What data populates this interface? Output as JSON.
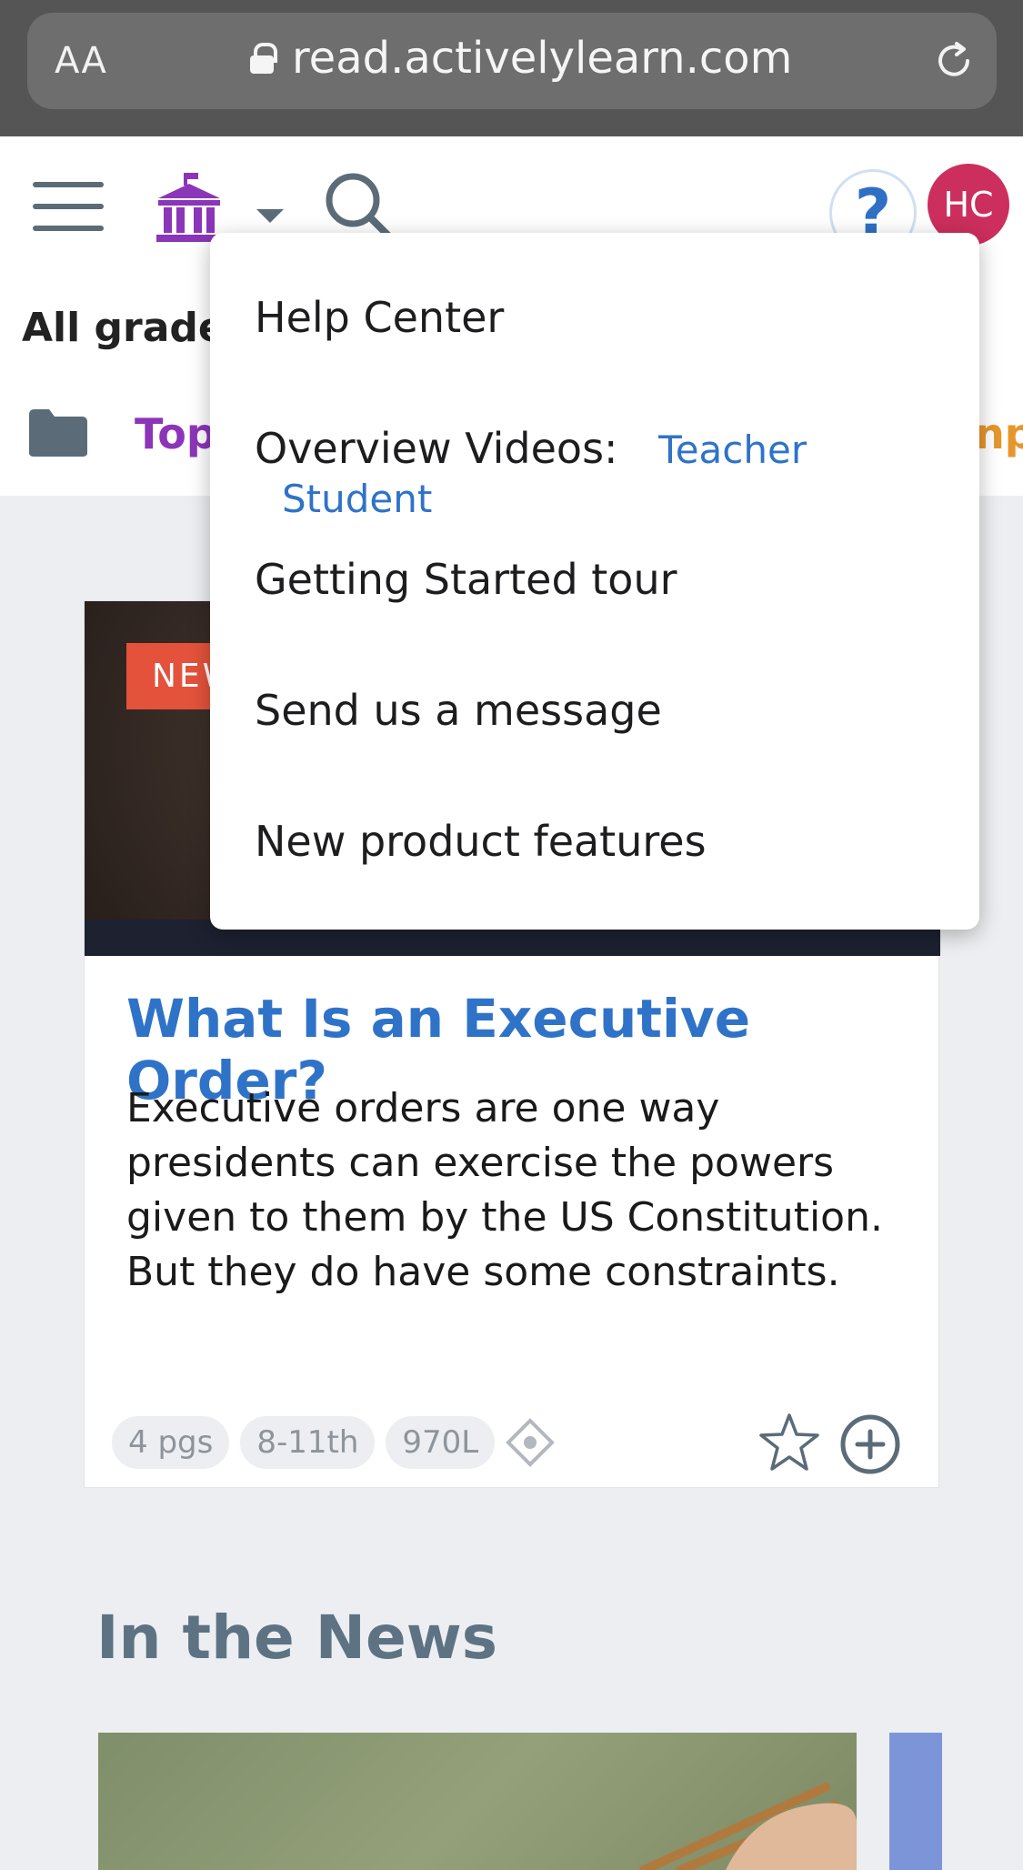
{
  "browser": {
    "text_size_label": "AA",
    "url": "read.activelylearn.com"
  },
  "header": {
    "help_label": "?",
    "avatar_initials": "HC",
    "grade_filter_label": "All grades",
    "topics_label": "Top",
    "clipped_right_label": "np"
  },
  "help_menu": {
    "help_center": "Help Center",
    "overview_videos_label": "Overview Videos:",
    "teacher_link": "Teacher",
    "student_link": "Student",
    "getting_started": "Getting Started tour",
    "send_message": "Send us a message",
    "new_features": "New product features"
  },
  "card": {
    "badge": "NEW",
    "title": "What Is an Executive Order?",
    "description": "Executive orders are one way presidents can exercise the powers given to them by the US Constitution. But they do have some constraints.",
    "pages": "4 pgs",
    "grades": "8-11th",
    "lexile": "970L"
  },
  "sections": {
    "in_the_news": "In the News"
  },
  "colors": {
    "accent_blue": "#2f73c8",
    "avatar": "#cc2e5d",
    "library_purple": "#8b35b8",
    "badge_red": "#e4523b"
  },
  "icons": {
    "menu": "hamburger-icon",
    "library": "library-icon",
    "search": "search-icon",
    "help": "question-icon",
    "reload": "reload-icon",
    "folder": "folder-icon",
    "favorite": "star-icon",
    "add": "plus-circle-icon",
    "lexile": "diamond-icon",
    "lock": "lock-icon"
  }
}
